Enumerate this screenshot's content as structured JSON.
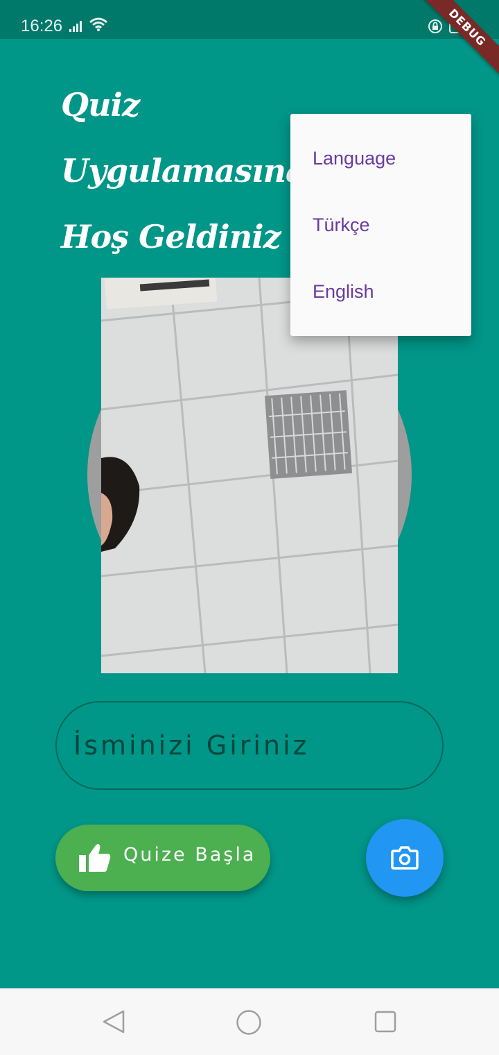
{
  "status_bar": {
    "time": "16:26",
    "icons": [
      "signal-icon",
      "wifi-icon",
      "rotate-lock-icon",
      "battery-icon"
    ]
  },
  "debug_banner": "DEBUG",
  "title": {
    "line1": "Quiz",
    "line2": "Uygulamasına",
    "line3": "Hoş Geldiniz"
  },
  "name_input": {
    "placeholder": "İsminizi Giriniz"
  },
  "start_button": {
    "label": "Quize Başla",
    "icon": "thumb-up-icon"
  },
  "camera_button": {
    "icon": "camera-icon"
  },
  "language_menu": {
    "items": [
      "Language",
      "Türkçe",
      "English"
    ]
  },
  "nav_bar": {
    "icons": [
      "back-icon",
      "home-icon",
      "recents-icon"
    ]
  },
  "colors": {
    "background": "#009688",
    "status_bar": "#00796B",
    "start_button": "#4CAF50",
    "camera_fab": "#2196F3",
    "menu_text": "#6A3AA0"
  }
}
